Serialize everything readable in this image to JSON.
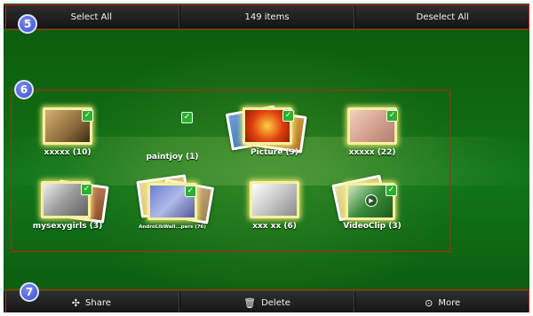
{
  "top_bar": {
    "select_all": "Select All",
    "item_count": "149 items",
    "deselect_all": "Deselect All"
  },
  "badges": {
    "top": "5",
    "grid": "6",
    "bottom": "7"
  },
  "albums": [
    {
      "label": "xxxxx (10)",
      "selected": true
    },
    {
      "label": "paintjoy (1)",
      "selected": true
    },
    {
      "label": "Picture (9)",
      "selected": true
    },
    {
      "label": "xxxxx (22)",
      "selected": true
    },
    {
      "label": "mysexygirls (3)",
      "selected": true
    },
    {
      "label": "AndroLibWall...pers (76)",
      "selected": true
    },
    {
      "label": "xxx xx (6)",
      "selected": true
    },
    {
      "label": "VideoClip (3)",
      "selected": true
    }
  ],
  "bottom_bar": {
    "share": "Share",
    "delete": "Delete",
    "more": "More"
  },
  "icons": {
    "share": "share-icon",
    "delete": "trash-icon",
    "more": "more-icon",
    "check": "check-icon",
    "play": "play-icon"
  },
  "colors": {
    "annotation_red": "#d01818",
    "badge_blue": "#3c50d0",
    "check_green": "#2db02d",
    "background_green": "#0f6a12"
  }
}
